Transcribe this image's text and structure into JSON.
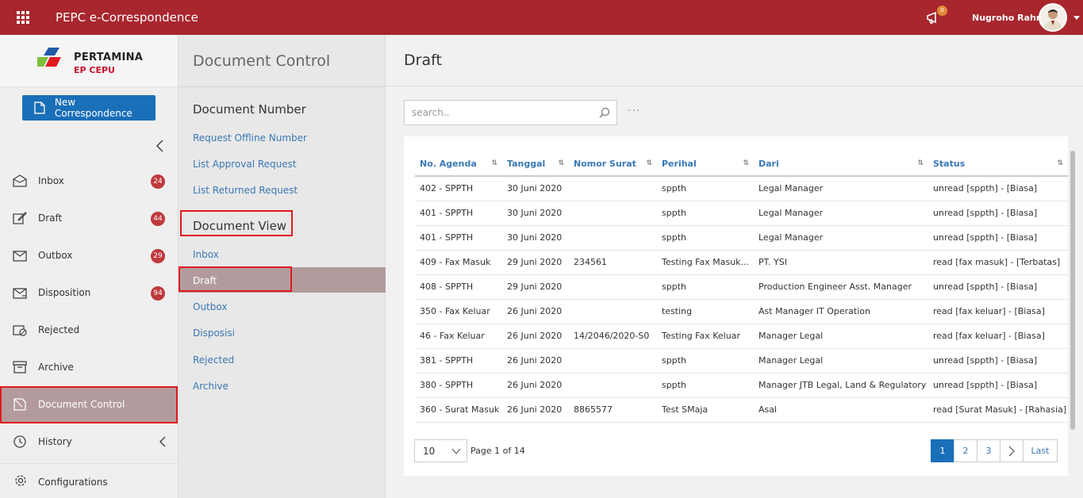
{
  "app": {
    "title": "PEPC e-Correspondence",
    "user_name": "Nugroho Rahm",
    "notif_count": "0"
  },
  "brand": {
    "name": "PERTAMINA",
    "sub": "EP CEPU"
  },
  "sidebar": {
    "new_button": "New Correspondence",
    "items": [
      {
        "label": "Inbox",
        "badge": "24"
      },
      {
        "label": "Draft",
        "badge": "44"
      },
      {
        "label": "Outbox",
        "badge": "29"
      },
      {
        "label": "Disposition",
        "badge": "94"
      },
      {
        "label": "Rejected"
      },
      {
        "label": "Archive"
      },
      {
        "label": "Document Control"
      },
      {
        "label": "History"
      }
    ],
    "config_label": "Configurations"
  },
  "panel": {
    "title": "Document Control",
    "number_section": "Document Number",
    "number_links": [
      "Request Offline Number",
      "List Approval Request",
      "List Returned Request"
    ],
    "view_section": "Document View",
    "view_links": [
      "Inbox",
      "Draft",
      "Outbox",
      "Disposisi",
      "Rejected",
      "Archive"
    ]
  },
  "main": {
    "title": "Draft",
    "search_placeholder": "search..",
    "more": "···",
    "columns": [
      "No. Agenda",
      "Tanggal",
      "Nomor Surat",
      "Perihal",
      "Dari",
      "Status"
    ],
    "rows": [
      [
        "402 - SPPTH",
        "30 Juni 2020",
        "",
        "sppth",
        "Legal Manager",
        "unread [sppth] - [Biasa]"
      ],
      [
        "401 - SPPTH",
        "30 Juni 2020",
        "",
        "sppth",
        "Legal Manager",
        "unread [sppth] - [Biasa]"
      ],
      [
        "401 - SPPTH",
        "30 Juni 2020",
        "",
        "sppth",
        "Legal Manager",
        "unread [sppth] - [Biasa]"
      ],
      [
        "409 - Fax Masuk",
        "29 Juni 2020",
        "234561",
        "Testing Fax Masuk...",
        "PT. YSI",
        "read [fax masuk] - [Terbatas]"
      ],
      [
        "408 - SPPTH",
        "29 Juni 2020",
        "",
        "sppth",
        "Production Engineer Asst. Manager",
        "unread [sppth] - [Biasa]"
      ],
      [
        "350 - Fax Keluar",
        "26 Juni 2020",
        "",
        "testing",
        "Ast Manager IT Operation",
        "read [fax keluar] - [Biasa]"
      ],
      [
        "46 - Fax Keluar",
        "26 Juni 2020",
        "14/2046/2020-S0",
        "Testing Fax Keluar",
        "Manager Legal",
        "read [fax keluar] - [Biasa]"
      ],
      [
        "381 - SPPTH",
        "26 Juni 2020",
        "",
        "sppth",
        "Manager Legal",
        "unread [sppth] - [Biasa]"
      ],
      [
        "380 - SPPTH",
        "26 Juni 2020",
        "",
        "sppth",
        "Manager JTB Legal, Land & Regulatory",
        "unread [sppth] - [Biasa]"
      ],
      [
        "360 - Surat Masuk",
        "26 Juni 2020",
        "8865577",
        "Test SMaja",
        "Asal",
        "read [Surat Masuk] - [Rahasia]"
      ]
    ],
    "page_size": "10",
    "page_info": "Page 1 of 14",
    "pages": [
      "1",
      "2",
      "3"
    ],
    "last_label": "Last"
  },
  "colors": {
    "topbar": "#a8262d",
    "primary": "#1a6fb9",
    "link": "#3a78b5",
    "badge": "#c0393d",
    "highlight": "#e0191f"
  }
}
